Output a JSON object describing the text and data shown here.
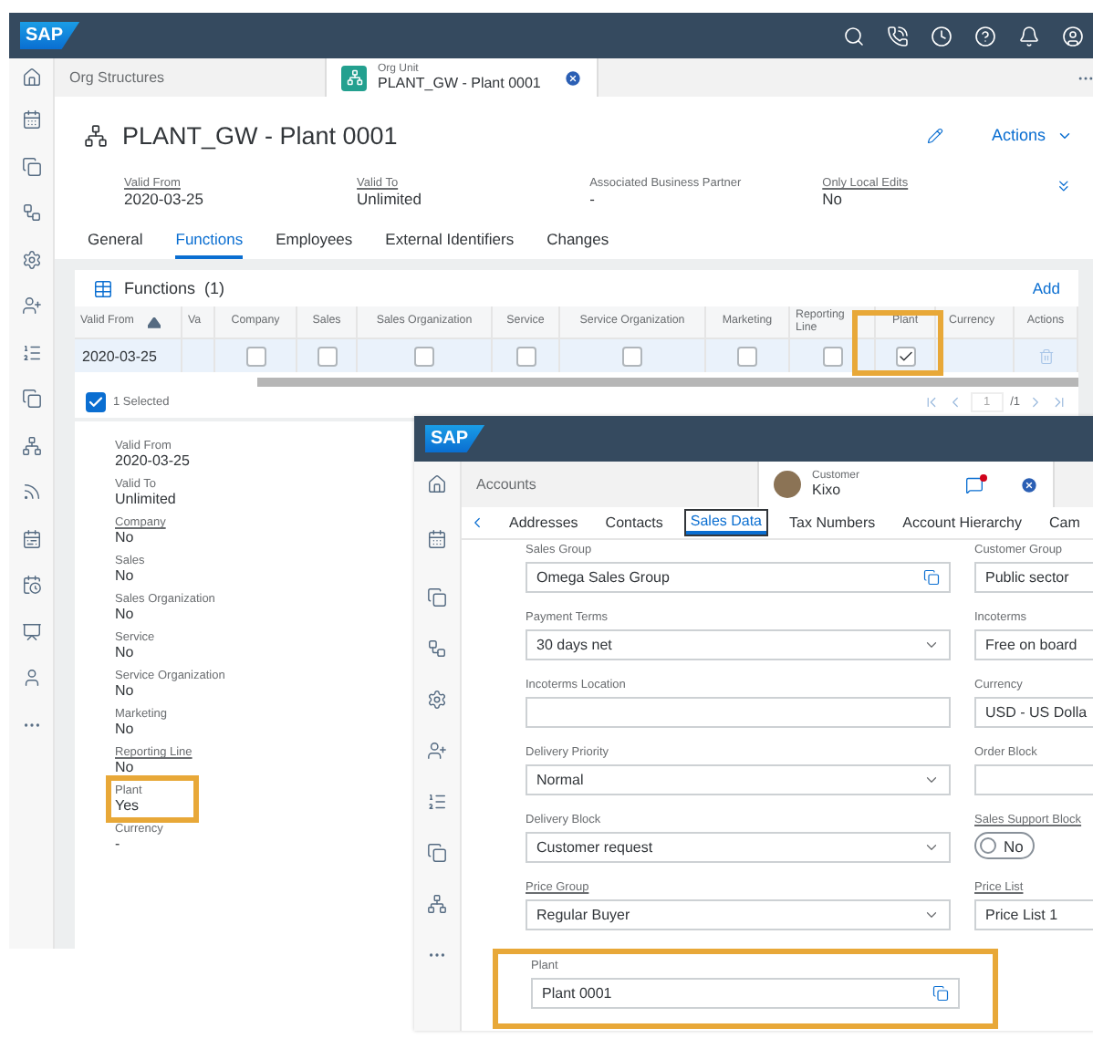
{
  "back": {
    "logo": "SAP",
    "tabs": [
      {
        "label": "Org Structures",
        "selected": false
      },
      {
        "subtitle": "Org Unit",
        "label": "PLANT_GW - Plant 0001",
        "selected": true
      }
    ],
    "header": {
      "title": "PLANT_GW - Plant 0001",
      "actions": "Actions",
      "fields": [
        {
          "label": "Valid From",
          "value": "2020-03-25",
          "link": true
        },
        {
          "label": "Valid To",
          "value": "Unlimited",
          "link": true
        },
        {
          "label": "Associated Business Partner",
          "value": "-",
          "link": false
        },
        {
          "label": "Only Local Edits",
          "value": "No",
          "link": true
        }
      ]
    },
    "section_tabs": [
      {
        "label": "General",
        "selected": false
      },
      {
        "label": "Functions",
        "selected": true
      },
      {
        "label": "Employees",
        "selected": false
      },
      {
        "label": "External Identifiers",
        "selected": false
      },
      {
        "label": "Changes",
        "selected": false
      }
    ],
    "functions": {
      "title": "Functions",
      "count": "(1)",
      "add": "Add",
      "columns": [
        {
          "label": "Valid From",
          "kind": "date",
          "highlighted": false
        },
        {
          "label": "Va",
          "kind": "blank",
          "highlighted": false
        },
        {
          "label": "Company",
          "kind": "check",
          "highlighted": false
        },
        {
          "label": "Sales",
          "kind": "check",
          "highlighted": false
        },
        {
          "label": "Sales Organization",
          "kind": "check",
          "highlighted": false
        },
        {
          "label": "Service",
          "kind": "check",
          "highlighted": false
        },
        {
          "label": "Service Organization",
          "kind": "check",
          "highlighted": false
        },
        {
          "label": "Marketing",
          "kind": "check",
          "highlighted": false
        },
        {
          "label": "Reporting Line",
          "kind": "check",
          "highlighted": false
        },
        {
          "label": "Plant",
          "kind": "check",
          "highlighted": true
        },
        {
          "label": "Currency",
          "kind": "blank",
          "highlighted": false
        },
        {
          "label": "Actions",
          "kind": "action",
          "highlighted": false
        }
      ],
      "rows": [
        {
          "valid_from": "2020-03-25",
          "selected": true,
          "checks": [
            false,
            false,
            false,
            false,
            false,
            false,
            false,
            true
          ]
        }
      ],
      "all_selected": true,
      "selected_text": "1 Selected",
      "page": "1",
      "total": "/1"
    },
    "details": [
      {
        "label": "Valid From",
        "value": "2020-03-25",
        "link": false,
        "highlighted": false
      },
      {
        "label": "Valid To",
        "value": "Unlimited",
        "link": false,
        "highlighted": false
      },
      {
        "label": "Company",
        "value": "No",
        "link": true,
        "highlighted": false
      },
      {
        "label": "Sales",
        "value": "No",
        "link": false,
        "highlighted": false
      },
      {
        "label": "Sales Organization",
        "value": "No",
        "link": false,
        "highlighted": false
      },
      {
        "label": "Service",
        "value": "No",
        "link": false,
        "highlighted": false
      },
      {
        "label": "Service Organization",
        "value": "No",
        "link": false,
        "highlighted": false
      },
      {
        "label": "Marketing",
        "value": "No",
        "link": false,
        "highlighted": false
      },
      {
        "label": "Reporting Line",
        "value": "No",
        "link": true,
        "highlighted": false
      },
      {
        "label": "Plant",
        "value": "Yes",
        "link": false,
        "highlighted": true
      },
      {
        "label": "Currency",
        "value": "-",
        "link": false,
        "highlighted": false
      }
    ]
  },
  "front": {
    "logo": "SAP",
    "tabs": [
      {
        "label": "Accounts",
        "selected": false
      },
      {
        "subtitle": "Customer",
        "label": "Kixo",
        "selected": true,
        "notification": true
      }
    ],
    "section_tabs": [
      {
        "label": "Addresses",
        "selected": false
      },
      {
        "label": "Contacts",
        "selected": false
      },
      {
        "label": "Sales Data",
        "selected": true
      },
      {
        "label": "Tax Numbers",
        "selected": false
      },
      {
        "label": "Account Hierarchy",
        "selected": false
      },
      {
        "label": "Cam",
        "selected": false
      }
    ],
    "rows": [
      {
        "left": {
          "label": "Sales Group",
          "value": "Omega Sales Group",
          "kind": "lookup",
          "link": false
        },
        "right": {
          "label": "Customer Group",
          "value": "Public sector",
          "kind": "text",
          "link": false
        }
      },
      {
        "left": {
          "label": "Payment Terms",
          "value": "30 days net",
          "kind": "select",
          "link": false
        },
        "right": {
          "label": "Incoterms",
          "value": "Free on board",
          "kind": "text",
          "link": false
        }
      },
      {
        "left": {
          "label": "Incoterms Location",
          "kind": "text",
          "link": false
        },
        "right": {
          "label": "Currency",
          "value": "USD - US Dolla",
          "kind": "text",
          "link": false
        }
      },
      {
        "left": {
          "label": "Delivery Priority",
          "value": "Normal",
          "kind": "select",
          "link": false
        },
        "right": {
          "label": "Order Block",
          "kind": "text",
          "link": false
        }
      },
      {
        "left": {
          "label": "Delivery Block",
          "value": "Customer request",
          "kind": "select",
          "link": false
        },
        "right": {
          "label": "Sales Support Block",
          "value": "No",
          "kind": "toggle",
          "on": false,
          "link": true
        }
      },
      {
        "left": {
          "label": "Price Group",
          "value": "Regular Buyer",
          "kind": "select",
          "link": true
        },
        "right": {
          "label": "Price List",
          "value": "Price List 1",
          "kind": "text",
          "link": true
        }
      }
    ],
    "plant": {
      "label": "Plant",
      "value": "Plant 0001",
      "kind": "lookup",
      "link": false,
      "highlighted": true
    }
  }
}
